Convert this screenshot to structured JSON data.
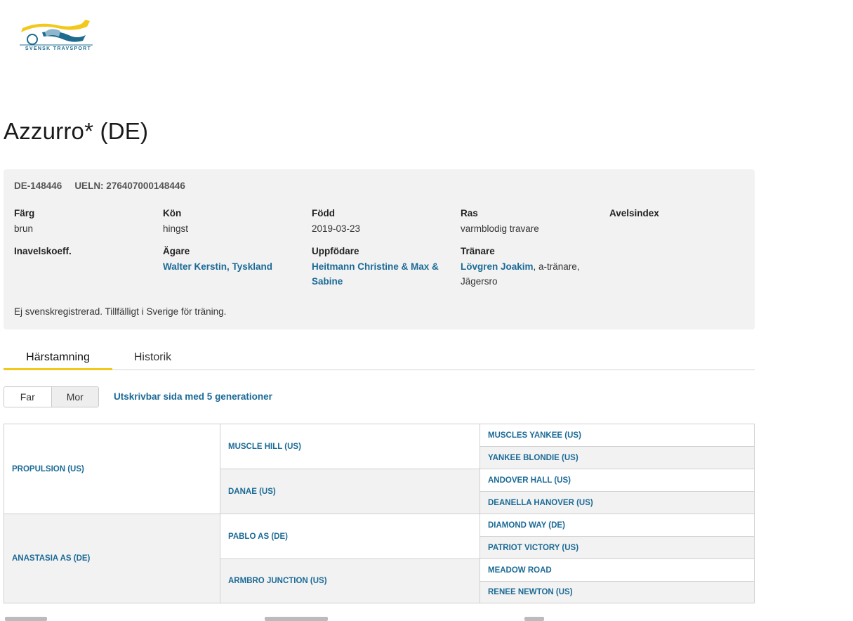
{
  "logo": {
    "name": "Svensk Travsport",
    "text": "SVENSK TRAVSPORT",
    "colors": {
      "yellow": "#f2c81b",
      "blue": "#1d6b8f"
    }
  },
  "horse": {
    "title": "Azzurro* (DE)",
    "reg_number": "DE-148446",
    "ueln": "UELN: 276407000148446"
  },
  "info": {
    "farg": {
      "label": "Färg",
      "value": "brun"
    },
    "kon": {
      "label": "Kön",
      "value": "hingst"
    },
    "fodd": {
      "label": "Född",
      "value": "2019-03-23"
    },
    "ras": {
      "label": "Ras",
      "value": "varmblodig travare"
    },
    "avelsindex": {
      "label": "Avelsindex",
      "value": ""
    },
    "inavelskoeff": {
      "label": "Inavelskoeff.",
      "value": ""
    },
    "agare": {
      "label": "Ägare",
      "value": "Walter Kerstin, Tyskland"
    },
    "uppfodare": {
      "label": "Uppfödare",
      "value_line1": "Heitmann Christine & Max &",
      "value_line2": "Sabine"
    },
    "tranare": {
      "label": "Tränare",
      "name": "Lövgren Joakim",
      "suffix": ", a-tränare,",
      "location": "Jägersro"
    },
    "note": "Ej svenskregistrerad. Tillfälligt i Sverige för träning."
  },
  "tabs": [
    {
      "label": "Härstamning",
      "active": true
    },
    {
      "label": "Historik",
      "active": false
    }
  ],
  "toggle": {
    "far": "Far",
    "mor": "Mor",
    "selected": "Far"
  },
  "print_link": "Utskrivbar sida med 5 generationer",
  "pedigree": {
    "gen1": [
      "PROPULSION (US)",
      "ANASTASIA AS (DE)"
    ],
    "gen2": [
      "MUSCLE HILL (US)",
      "DANAE (US)",
      "PABLO AS (DE)",
      "ARMBRO JUNCTION (US)"
    ],
    "gen3": [
      "MUSCLES YANKEE (US)",
      "YANKEE BLONDIE (US)",
      "ANDOVER HALL (US)",
      "DEANELLA HANOVER (US)",
      "DIAMOND WAY (DE)",
      "PATRIOT VICTORY (US)",
      "MEADOW ROAD",
      "RENEE NEWTON (US)"
    ]
  }
}
